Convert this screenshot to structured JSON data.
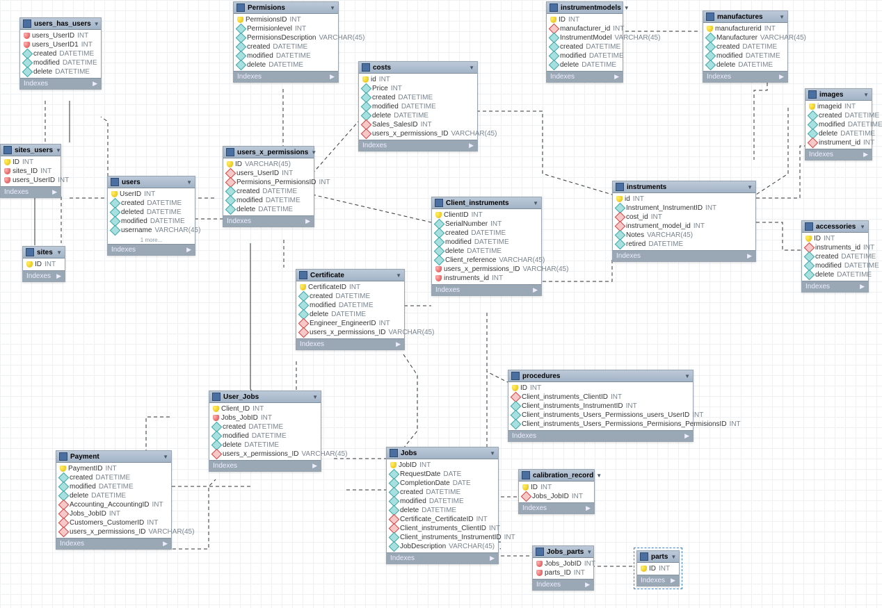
{
  "indexes_label": "Indexes",
  "more_label": "1 more...",
  "tables": {
    "users_has_users": {
      "title": "users_has_users",
      "cols": [
        {
          "ic": "keyr",
          "n": "users_UserID",
          "t": "INT"
        },
        {
          "ic": "keyr",
          "n": "users_UserID1",
          "t": "INT"
        },
        {
          "ic": "diam",
          "n": "created",
          "t": "DATETIME"
        },
        {
          "ic": "diam",
          "n": "modified",
          "t": "DATETIME"
        },
        {
          "ic": "diam",
          "n": "delete",
          "t": "DATETIME"
        }
      ]
    },
    "permissions": {
      "title": "Permisions",
      "cols": [
        {
          "ic": "key",
          "n": "PermisionsID",
          "t": "INT"
        },
        {
          "ic": "diam",
          "n": "Permisionlevel",
          "t": "INT"
        },
        {
          "ic": "diam",
          "n": "PermisionsDescription",
          "t": "VARCHAR(45)"
        },
        {
          "ic": "diam",
          "n": "created",
          "t": "DATETIME"
        },
        {
          "ic": "diam",
          "n": "modified",
          "t": "DATETIME"
        },
        {
          "ic": "diam",
          "n": "delete",
          "t": "DATETIME"
        }
      ]
    },
    "instrumentmodels": {
      "title": "instrumentmodels",
      "cols": [
        {
          "ic": "key",
          "n": "ID",
          "t": "INT"
        },
        {
          "ic": "diamr",
          "n": "manufacturer_id",
          "t": "INT"
        },
        {
          "ic": "diam",
          "n": "InstrumentModel",
          "t": "VARCHAR(45)"
        },
        {
          "ic": "diam",
          "n": "created",
          "t": "DATETIME"
        },
        {
          "ic": "diam",
          "n": "modified",
          "t": "DATETIME"
        },
        {
          "ic": "diam",
          "n": "delete",
          "t": "DATETIME"
        }
      ]
    },
    "manufactures": {
      "title": "manufactures",
      "cols": [
        {
          "ic": "key",
          "n": "manufacturerid",
          "t": "INT"
        },
        {
          "ic": "diam",
          "n": "Manufacturer",
          "t": "VARCHAR(45)"
        },
        {
          "ic": "diam",
          "n": "created",
          "t": "DATETIME"
        },
        {
          "ic": "diam",
          "n": "modified",
          "t": "DATETIME"
        },
        {
          "ic": "diam",
          "n": "delete",
          "t": "DATETIME"
        }
      ]
    },
    "costs": {
      "title": "costs",
      "cols": [
        {
          "ic": "key",
          "n": "id",
          "t": "INT"
        },
        {
          "ic": "diam",
          "n": "Price",
          "t": "INT"
        },
        {
          "ic": "diam",
          "n": "created",
          "t": "DATETIME"
        },
        {
          "ic": "diam",
          "n": "modified",
          "t": "DATETIME"
        },
        {
          "ic": "diam",
          "n": "delete",
          "t": "DATETIME"
        },
        {
          "ic": "diamr",
          "n": "Sales_SalesID",
          "t": "INT"
        },
        {
          "ic": "diamr",
          "n": "users_x_permissions_ID",
          "t": "VARCHAR(45)"
        }
      ]
    },
    "images": {
      "title": "images",
      "cols": [
        {
          "ic": "key",
          "n": "imageid",
          "t": "INT"
        },
        {
          "ic": "diam",
          "n": "created",
          "t": "DATETIME"
        },
        {
          "ic": "diam",
          "n": "modified",
          "t": "DATETIME"
        },
        {
          "ic": "diam",
          "n": "delete",
          "t": "DATETIME"
        },
        {
          "ic": "diamr",
          "n": "instrument_id",
          "t": "INT"
        }
      ]
    },
    "sites_users": {
      "title": "sites_users",
      "cols": [
        {
          "ic": "key",
          "n": "ID",
          "t": "INT"
        },
        {
          "ic": "keyr",
          "n": "sites_ID",
          "t": "INT"
        },
        {
          "ic": "keyr",
          "n": "users_UserID",
          "t": "INT"
        }
      ]
    },
    "users": {
      "title": "users",
      "cols": [
        {
          "ic": "key",
          "n": "UserID",
          "t": "INT"
        },
        {
          "ic": "diam",
          "n": "created",
          "t": "DATETIME"
        },
        {
          "ic": "diam",
          "n": "deleted",
          "t": "DATETIME"
        },
        {
          "ic": "diam",
          "n": "modified",
          "t": "DATETIME"
        },
        {
          "ic": "diam",
          "n": "username",
          "t": "VARCHAR(45)"
        }
      ]
    },
    "users_x_permissions": {
      "title": "users_x_permissions",
      "cols": [
        {
          "ic": "key",
          "n": "ID",
          "t": "VARCHAR(45)"
        },
        {
          "ic": "diamr",
          "n": "users_UserID",
          "t": "INT"
        },
        {
          "ic": "diamr",
          "n": "Permisions_PermisionsID",
          "t": "INT"
        },
        {
          "ic": "diam",
          "n": "created",
          "t": "DATETIME"
        },
        {
          "ic": "diam",
          "n": "modified",
          "t": "DATETIME"
        },
        {
          "ic": "diam",
          "n": "delete",
          "t": "DATETIME"
        }
      ]
    },
    "instruments": {
      "title": "instruments",
      "cols": [
        {
          "ic": "key",
          "n": "id",
          "t": "INT"
        },
        {
          "ic": "diam",
          "n": "Instrument_InstrumentID",
          "t": "INT"
        },
        {
          "ic": "diamr",
          "n": "cost_id",
          "t": "INT"
        },
        {
          "ic": "diamr",
          "n": "instrument_model_id",
          "t": "INT"
        },
        {
          "ic": "diam",
          "n": "Notes",
          "t": "VARCHAR(45)"
        },
        {
          "ic": "diam",
          "n": "retired",
          "t": "DATETIME"
        }
      ]
    },
    "sites": {
      "title": "sites",
      "cols": [
        {
          "ic": "key",
          "n": "ID",
          "t": "INT"
        }
      ]
    },
    "client_instruments": {
      "title": "Client_instruments",
      "cols": [
        {
          "ic": "key",
          "n": "ClientID",
          "t": "INT"
        },
        {
          "ic": "diam",
          "n": "SerialNumber",
          "t": "INT"
        },
        {
          "ic": "diam",
          "n": "created",
          "t": "DATETIME"
        },
        {
          "ic": "diam",
          "n": "modified",
          "t": "DATETIME"
        },
        {
          "ic": "diam",
          "n": "delete",
          "t": "DATETIME"
        },
        {
          "ic": "diam",
          "n": "Client_reference",
          "t": "VARCHAR(45)"
        },
        {
          "ic": "keyr",
          "n": "users_x_permissions_ID",
          "t": "VARCHAR(45)"
        },
        {
          "ic": "keyr",
          "n": "instruments_id",
          "t": "INT"
        }
      ]
    },
    "accessories": {
      "title": "accessories",
      "cols": [
        {
          "ic": "key",
          "n": "ID",
          "t": "INT"
        },
        {
          "ic": "diamr",
          "n": "instruments_id",
          "t": "INT"
        },
        {
          "ic": "diam",
          "n": "created",
          "t": "DATETIME"
        },
        {
          "ic": "diam",
          "n": "modified",
          "t": "DATETIME"
        },
        {
          "ic": "diam",
          "n": "delete",
          "t": "DATETIME"
        }
      ]
    },
    "certificate": {
      "title": "Certificate",
      "cols": [
        {
          "ic": "key",
          "n": "CertificateID",
          "t": "INT"
        },
        {
          "ic": "diam",
          "n": "created",
          "t": "DATETIME"
        },
        {
          "ic": "diam",
          "n": "modified",
          "t": "DATETIME"
        },
        {
          "ic": "diam",
          "n": "delete",
          "t": "DATETIME"
        },
        {
          "ic": "diamr",
          "n": "Engineer_EngineerID",
          "t": "INT"
        },
        {
          "ic": "diamr",
          "n": "users_x_permissions_ID",
          "t": "VARCHAR(45)"
        }
      ]
    },
    "procedures": {
      "title": "procedures",
      "cols": [
        {
          "ic": "key",
          "n": "ID",
          "t": "INT"
        },
        {
          "ic": "diamr",
          "n": "Client_instruments_ClientID",
          "t": "INT"
        },
        {
          "ic": "diam",
          "n": "Client_instruments_InstrumentID",
          "t": "INT"
        },
        {
          "ic": "diam",
          "n": "Client_instruments_Users_Permissions_users_UserID",
          "t": "INT"
        },
        {
          "ic": "diam",
          "n": "Client_instruments_Users_Permissions_Permisions_PermisionsID",
          "t": "INT"
        }
      ]
    },
    "user_jobs": {
      "title": "User_Jobs",
      "cols": [
        {
          "ic": "key",
          "n": "Client_ID",
          "t": "INT"
        },
        {
          "ic": "keyr",
          "n": "Jobs_JobID",
          "t": "INT"
        },
        {
          "ic": "diam",
          "n": "created",
          "t": "DATETIME"
        },
        {
          "ic": "diam",
          "n": "modified",
          "t": "DATETIME"
        },
        {
          "ic": "diam",
          "n": "delete",
          "t": "DATETIME"
        },
        {
          "ic": "diamr",
          "n": "users_x_permissions_ID",
          "t": "VARCHAR(45)"
        }
      ]
    },
    "payment": {
      "title": "Payment",
      "cols": [
        {
          "ic": "key",
          "n": "PaymentID",
          "t": "INT"
        },
        {
          "ic": "diam",
          "n": "created",
          "t": "DATETIME"
        },
        {
          "ic": "diam",
          "n": "modified",
          "t": "DATETIME"
        },
        {
          "ic": "diam",
          "n": "delete",
          "t": "DATETIME"
        },
        {
          "ic": "diamr",
          "n": "Accounting_AccountingID",
          "t": "INT"
        },
        {
          "ic": "diamr",
          "n": "Jobs_JobID",
          "t": "INT"
        },
        {
          "ic": "diamr",
          "n": "Customers_CustomerID",
          "t": "INT"
        },
        {
          "ic": "diamr",
          "n": "users_x_permissions_ID",
          "t": "VARCHAR(45)"
        }
      ]
    },
    "jobs": {
      "title": "Jobs",
      "cols": [
        {
          "ic": "key",
          "n": "JobID",
          "t": "INT"
        },
        {
          "ic": "diam",
          "n": "RequestDate",
          "t": "DATE"
        },
        {
          "ic": "diam",
          "n": "CompletionDate",
          "t": "DATE"
        },
        {
          "ic": "diam",
          "n": "created",
          "t": "DATETIME"
        },
        {
          "ic": "diam",
          "n": "modified",
          "t": "DATETIME"
        },
        {
          "ic": "diam",
          "n": "delete",
          "t": "DATETIME"
        },
        {
          "ic": "diamr",
          "n": "Certificate_CertificateID",
          "t": "INT"
        },
        {
          "ic": "diamr",
          "n": "Client_instruments_ClientID",
          "t": "INT"
        },
        {
          "ic": "diam",
          "n": "Client_instruments_InstrumentID",
          "t": "INT"
        },
        {
          "ic": "diam",
          "n": "JobDescription",
          "t": "VARCHAR(45)"
        }
      ]
    },
    "calibration_record": {
      "title": "calibration_record",
      "cols": [
        {
          "ic": "key",
          "n": "ID",
          "t": "INT"
        },
        {
          "ic": "diamr",
          "n": "Jobs_JobID",
          "t": "INT"
        }
      ]
    },
    "jobs_parts": {
      "title": "Jobs_parts",
      "cols": [
        {
          "ic": "keyr",
          "n": "Jobs_JobID",
          "t": "INT"
        },
        {
          "ic": "keyr",
          "n": "parts_ID",
          "t": "INT"
        }
      ]
    },
    "parts": {
      "title": "parts",
      "cols": [
        {
          "ic": "key",
          "n": "ID",
          "t": "INT"
        }
      ]
    }
  }
}
